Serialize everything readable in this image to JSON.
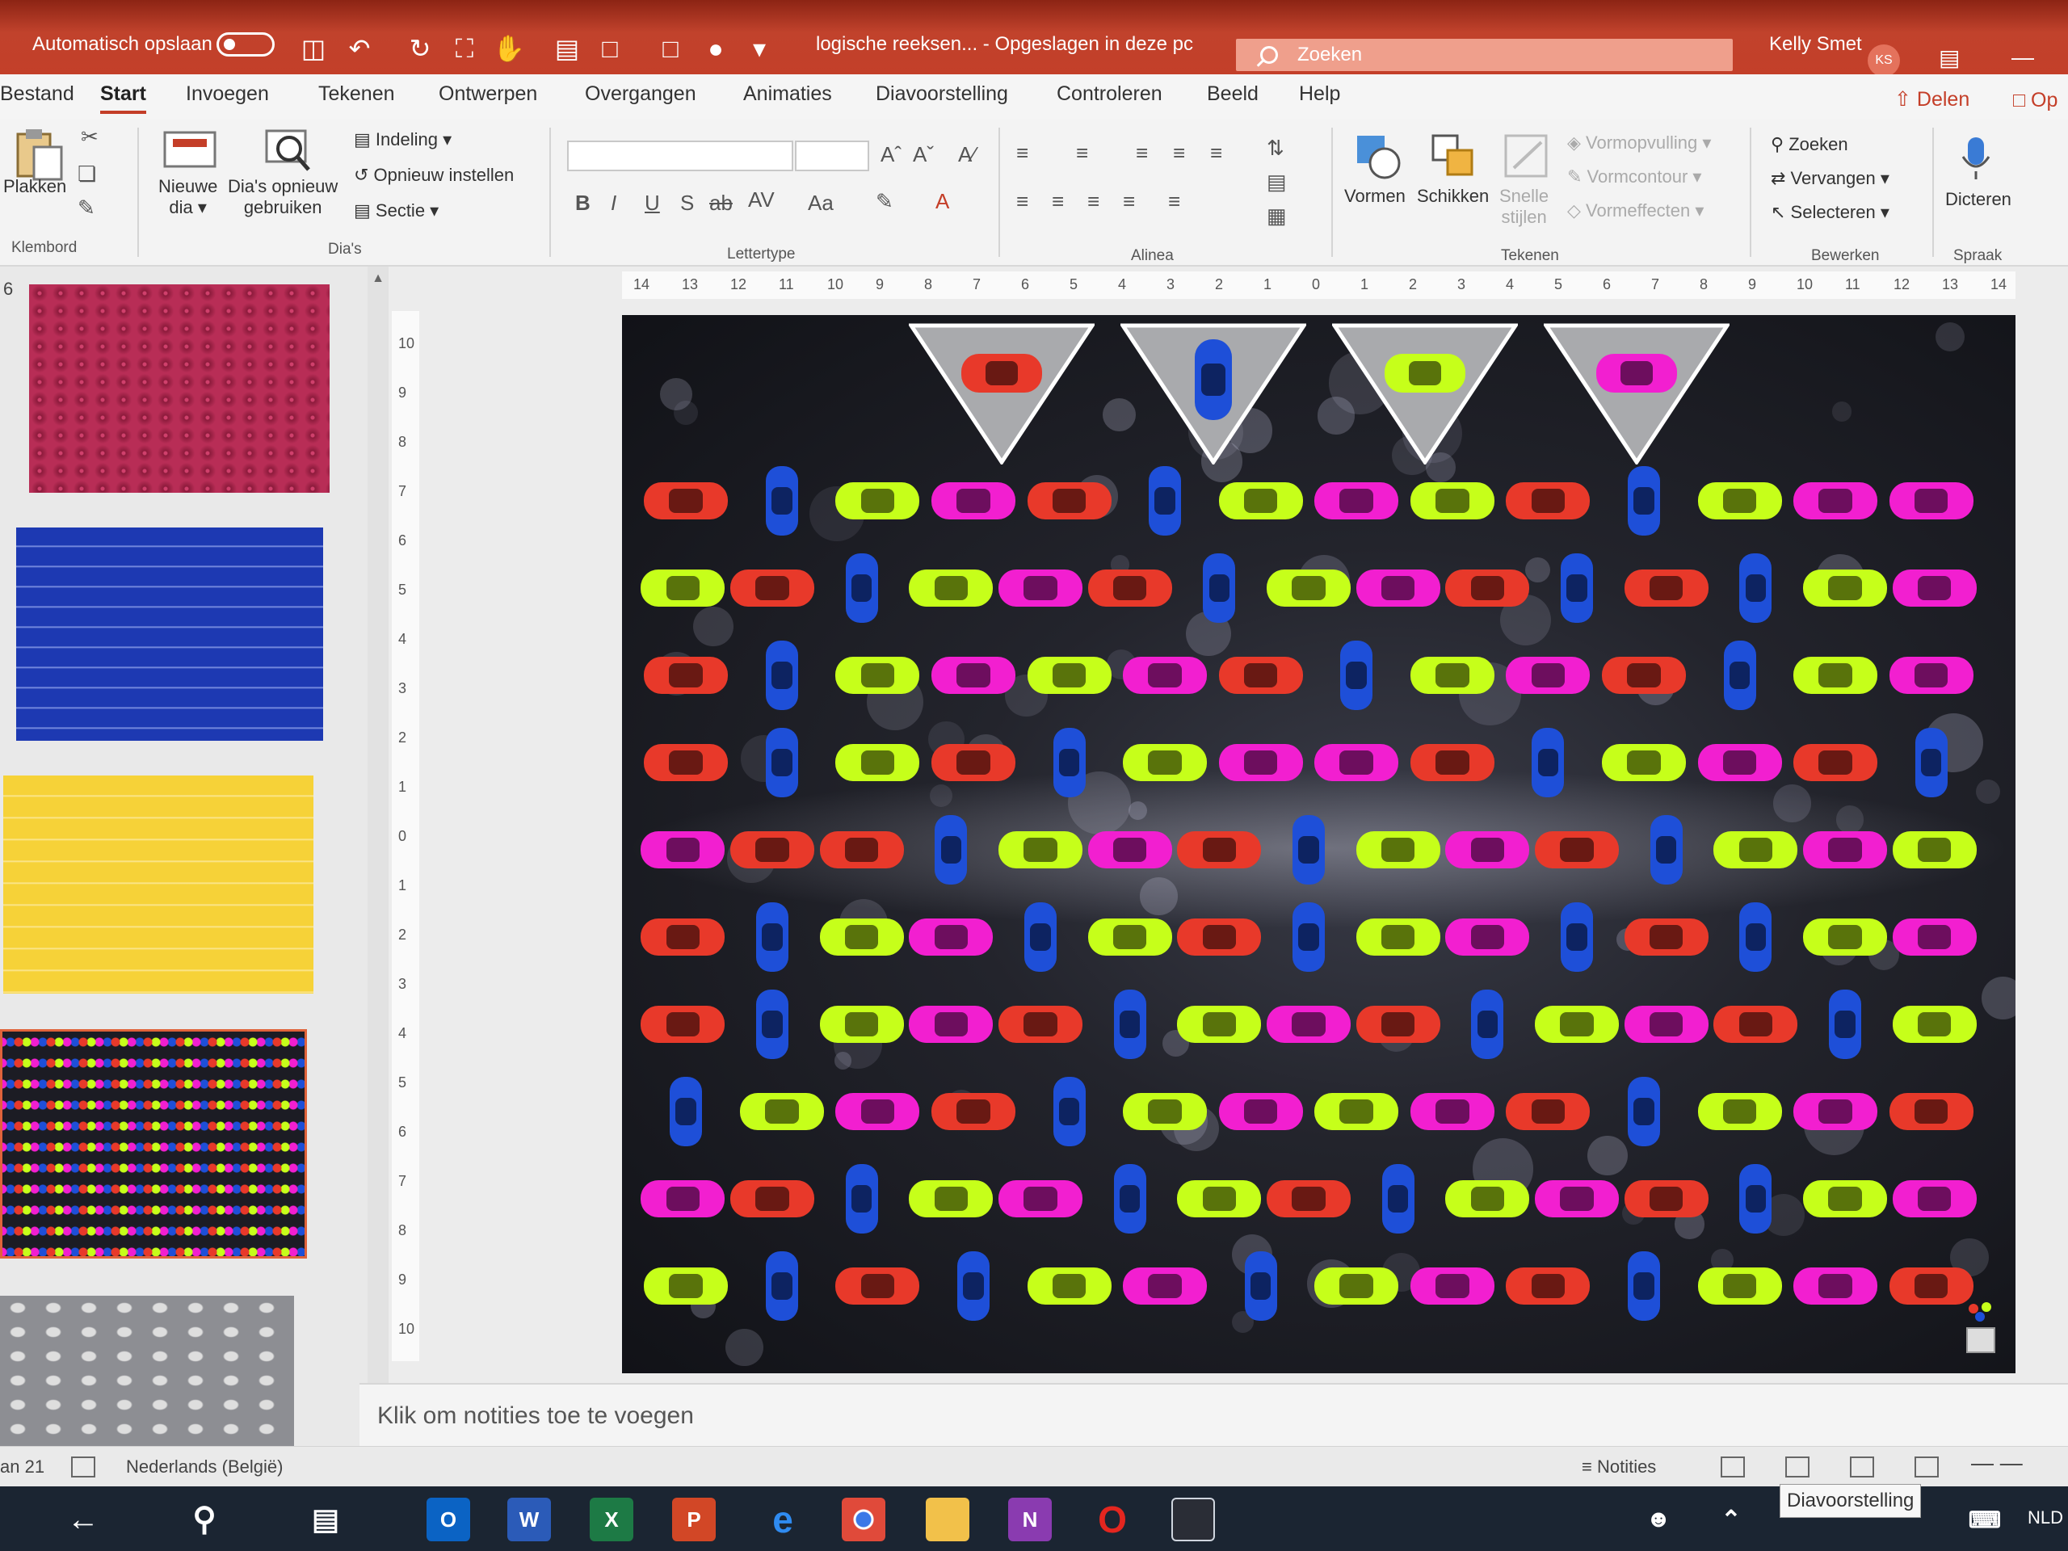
{
  "titlebar": {
    "autosave_label": "Automatisch opslaan",
    "doc_title": "logische reeksen... - Opgeslagen in deze pc",
    "search_placeholder": "Zoeken",
    "user_name": "Kelly Smet",
    "user_initials": "KS"
  },
  "menu": {
    "tabs": [
      "Bestand",
      "Start",
      "Invoegen",
      "Tekenen",
      "Ontwerpen",
      "Overgangen",
      "Animaties",
      "Diavoorstelling",
      "Controleren",
      "Beeld",
      "Help"
    ],
    "active": "Start",
    "share_label": "Delen",
    "comment_label": "Op"
  },
  "ribbon": {
    "clipboard": {
      "paste": "Plakken",
      "group": "Klembord"
    },
    "slides": {
      "new_slide_1": "Nieuwe",
      "new_slide_2": "dia",
      "reuse_1": "Dia's opnieuw",
      "reuse_2": "gebruiken",
      "layout": "Indeling",
      "reset": "Opnieuw instellen",
      "section": "Sectie",
      "group": "Dia's"
    },
    "font": {
      "group": "Lettertype"
    },
    "paragraph": {
      "group": "Alinea"
    },
    "drawing": {
      "shapes": "Vormen",
      "arrange": "Schikken",
      "quick_styles_1": "Snelle",
      "quick_styles_2": "stijlen",
      "fill": "Vormopvulling",
      "outline": "Vormcontour",
      "effects": "Vormeffecten",
      "group": "Tekenen"
    },
    "editing": {
      "find": "Zoeken",
      "replace": "Vervangen",
      "select": "Selecteren",
      "group": "Bewerken"
    },
    "voice": {
      "dictate": "Dicteren",
      "group": "Spraak"
    }
  },
  "thumbnails": {
    "first_number": "6"
  },
  "notes_placeholder": "Klik om notities toe te voegen",
  "status": {
    "slide_info": "an 21",
    "language": "Nederlands (België)",
    "notes_label": "Notities",
    "tooltip": "Diavoorstelling"
  },
  "taskbar": {
    "lang": "NLD"
  },
  "colors": {
    "red": "#e8392a",
    "blue": "#1e4fd8",
    "lime": "#c6ff1a",
    "magenta": "#f21fd0",
    "accent": "#c43e28"
  },
  "slide_content": {
    "pennant_cars": [
      "red",
      "blue",
      "lime",
      "magenta"
    ],
    "rows": [
      [
        "red",
        "blue",
        "lime",
        "magenta",
        "red",
        "blue",
        "lime",
        "magenta",
        "lime",
        "red",
        "blue",
        "lime",
        "magenta",
        "magenta"
      ],
      [
        "lime",
        "red",
        "blue",
        "lime",
        "magenta",
        "red",
        "blue",
        "lime",
        "magenta",
        "red",
        "blue",
        "red",
        "blue",
        "lime",
        "magenta"
      ],
      [
        "red",
        "blue",
        "lime",
        "magenta",
        "lime",
        "magenta",
        "red",
        "blue",
        "lime",
        "magenta",
        "red",
        "blue",
        "lime",
        "magenta"
      ],
      [
        "red",
        "blue",
        "lime",
        "red",
        "blue",
        "lime",
        "magenta",
        "magenta",
        "red",
        "blue",
        "lime",
        "magenta",
        "red",
        "blue"
      ],
      [
        "magenta",
        "red",
        "red",
        "blue",
        "lime",
        "magenta",
        "red",
        "blue",
        "lime",
        "magenta",
        "red",
        "blue",
        "lime",
        "magenta",
        "lime"
      ],
      [
        "red",
        "blue",
        "lime",
        "magenta",
        "blue",
        "lime",
        "red",
        "blue",
        "lime",
        "magenta",
        "blue",
        "red",
        "blue",
        "lime",
        "magenta"
      ],
      [
        "red",
        "blue",
        "lime",
        "magenta",
        "red",
        "blue",
        "lime",
        "magenta",
        "red",
        "blue",
        "lime",
        "magenta",
        "red",
        "blue",
        "lime"
      ],
      [
        "blue",
        "lime",
        "magenta",
        "red",
        "blue",
        "lime",
        "magenta",
        "lime",
        "magenta",
        "red",
        "blue",
        "lime",
        "magenta",
        "red"
      ],
      [
        "magenta",
        "red",
        "blue",
        "lime",
        "magenta",
        "blue",
        "lime",
        "red",
        "blue",
        "lime",
        "magenta",
        "red",
        "blue",
        "lime",
        "magenta"
      ],
      [
        "lime",
        "blue",
        "red",
        "blue",
        "lime",
        "magenta",
        "blue",
        "lime",
        "magenta",
        "red",
        "blue",
        "lime",
        "magenta",
        "red"
      ]
    ]
  }
}
